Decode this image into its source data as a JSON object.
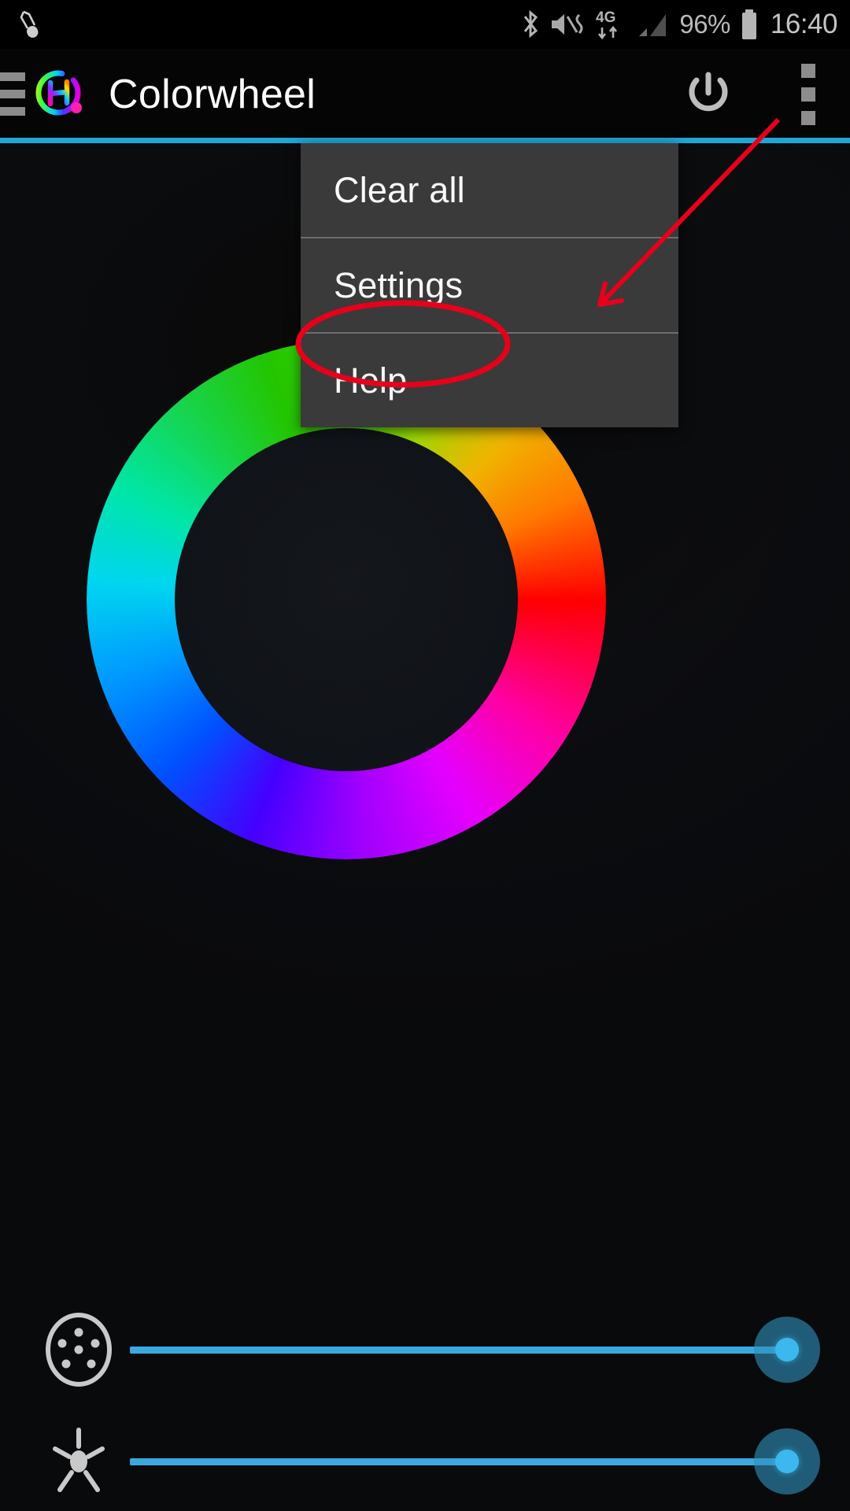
{
  "status_bar": {
    "left_icons": [
      {
        "name": "usb-debugging-icon",
        "glyph": "usb-debug"
      }
    ],
    "right_icons": [
      {
        "name": "bluetooth-icon",
        "glyph": "bluetooth"
      },
      {
        "name": "mute-vibrate-icon",
        "glyph": "sound-off-vibrate"
      },
      {
        "name": "network-4g-icon",
        "glyph": "4G"
      },
      {
        "name": "signal-strength-icon",
        "glyph": "signal-bars"
      }
    ],
    "battery_percent": "96%",
    "battery_icon": "battery-full-icon",
    "clock": "16:40"
  },
  "app_bar": {
    "drawer_label": "navigation-drawer",
    "logo_label": "colorwheel-hue-logo",
    "title": "Colorwheel",
    "power_label": "power-toggle",
    "overflow_label": "more-options",
    "accent_color": "#21a6d8"
  },
  "overflow_menu": {
    "visible": true,
    "background": "#3a3a3a",
    "items": [
      {
        "label": "Clear all",
        "name": "menu-item-clear-all"
      },
      {
        "label": "Settings",
        "name": "menu-item-settings"
      },
      {
        "label": "Help",
        "name": "menu-item-help"
      }
    ]
  },
  "color_wheel": {
    "name": "hue-color-wheel",
    "description": "circular hue gradient ring selector",
    "selected_hue": null,
    "hue_stops": [
      "#ff0000",
      "#ff7a00",
      "#f0b400",
      "#9ada00",
      "#3ddb00",
      "#24c500",
      "#17d44c",
      "#00e6a8",
      "#00d5f0",
      "#0096ff",
      "#0050ff",
      "#4400ff",
      "#a000ff",
      "#e400ff",
      "#ff00a0",
      "#ff0000"
    ]
  },
  "sliders": [
    {
      "name": "saturation-slider",
      "icon_name": "saturation-dots-icon",
      "value_percent": 100,
      "track_color": "#3aa9e0",
      "thumb_color": "#3db8ef"
    },
    {
      "name": "brightness-slider",
      "icon_name": "brightness-sun-icon",
      "value_percent": 100,
      "track_color": "#3aa9e0",
      "thumb_color": "#3db8ef"
    }
  ],
  "annotations": {
    "highlight_color": "#e8001b",
    "ellipse": {
      "target": "Settings",
      "name": "settings-highlight-ellipse"
    },
    "arrow": {
      "from": "more-options",
      "to": "Settings",
      "name": "pointer-arrow"
    }
  }
}
